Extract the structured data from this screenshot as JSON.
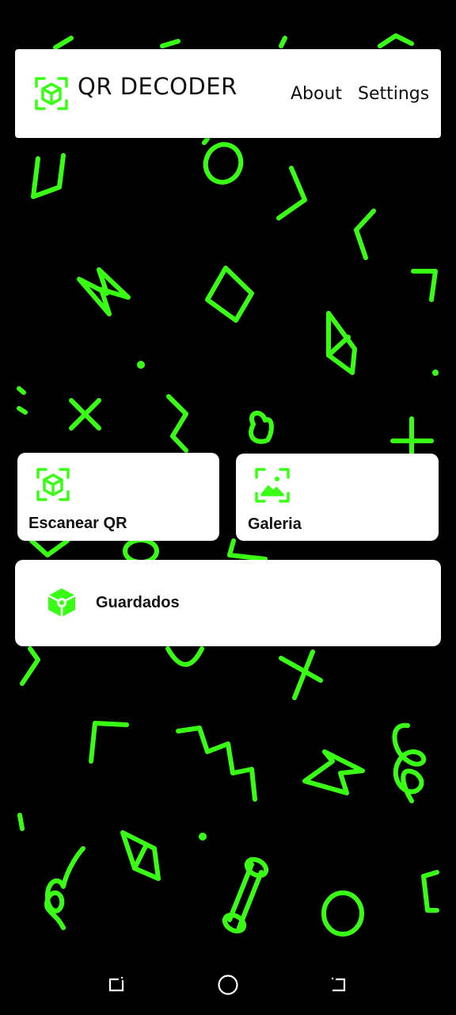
{
  "header": {
    "title": "QR DECODER",
    "logo_icon": "qr-cube-scan-icon",
    "nav": [
      {
        "label": "About"
      },
      {
        "label": "Settings"
      }
    ]
  },
  "cards": {
    "scan": {
      "label": "Escanear QR",
      "icon": "qr-cube-scan-icon"
    },
    "gallery": {
      "label": "Galeria",
      "icon": "image-scan-icon"
    },
    "saved": {
      "label": "Guardados",
      "icon": "cube-icon"
    }
  },
  "system_nav": {
    "recents": "recents-icon",
    "home": "home-icon",
    "back": "back-icon"
  },
  "colors": {
    "accent": "#39ff14",
    "background": "#000000",
    "card": "#ffffff",
    "text": "#111111"
  }
}
